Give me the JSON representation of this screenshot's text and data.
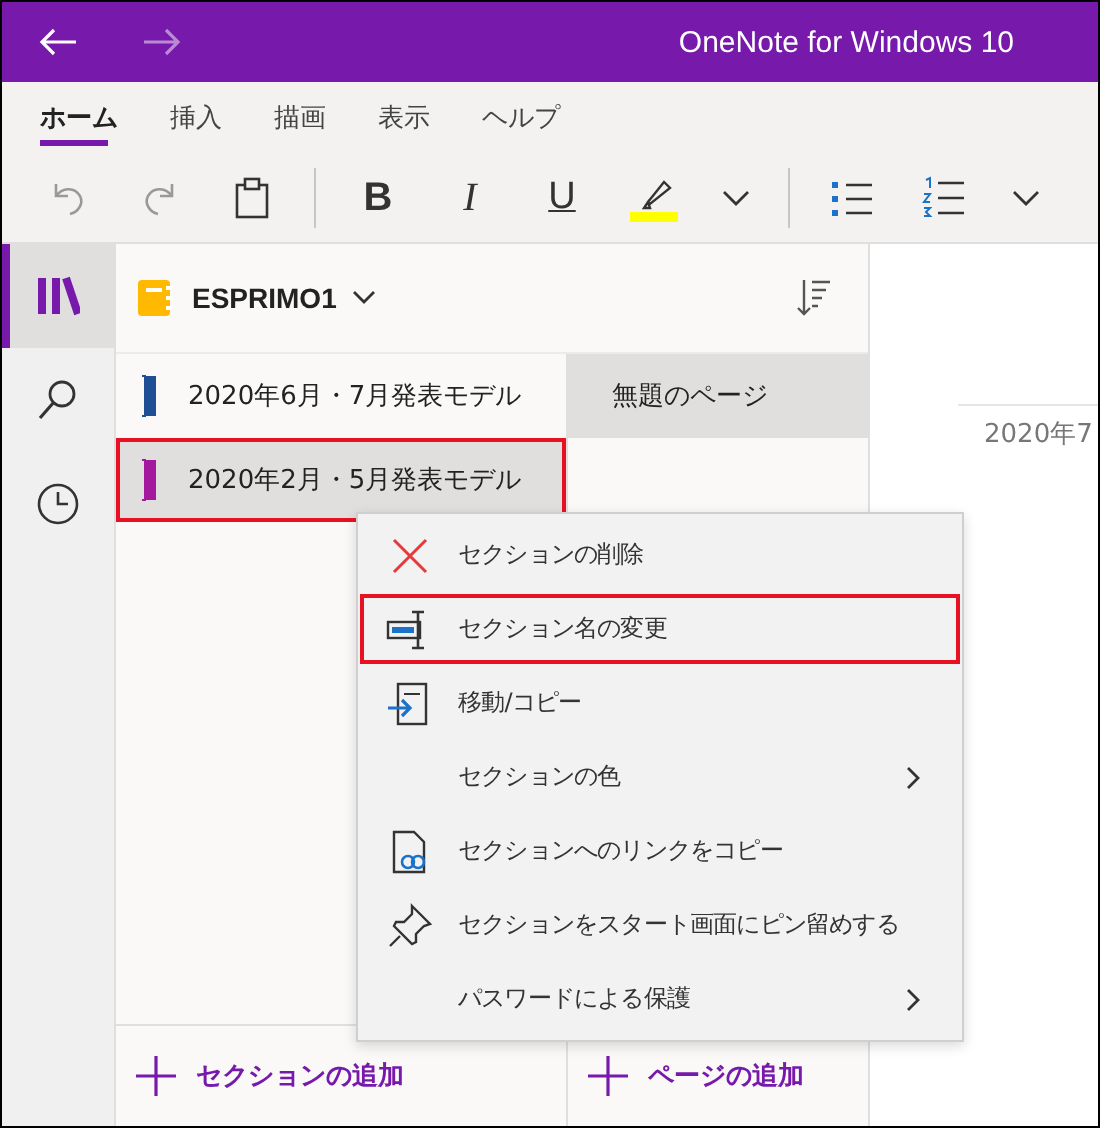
{
  "window": {
    "title": "OneNote for Windows 10",
    "back_enabled": true,
    "forward_enabled": false
  },
  "tabs": [
    {
      "label": "ホーム",
      "selected": true
    },
    {
      "label": "挿入",
      "selected": false
    },
    {
      "label": "描画",
      "selected": false
    },
    {
      "label": "表示",
      "selected": false
    },
    {
      "label": "ヘルプ",
      "selected": false
    }
  ],
  "toolbar": [
    {
      "kind": "undo",
      "disabled": true
    },
    {
      "kind": "redo",
      "disabled": true
    },
    {
      "kind": "paste",
      "disabled": false
    },
    {
      "kind": "divider"
    },
    {
      "kind": "bold",
      "label": "B"
    },
    {
      "kind": "italic",
      "label": "I"
    },
    {
      "kind": "underline",
      "label": "U"
    },
    {
      "kind": "highlight",
      "color": "#ffff00"
    },
    {
      "kind": "more"
    },
    {
      "kind": "divider"
    },
    {
      "kind": "bullets"
    },
    {
      "kind": "numbering"
    },
    {
      "kind": "more"
    }
  ],
  "rail": [
    {
      "kind": "notebooks",
      "selected": true
    },
    {
      "kind": "search",
      "selected": false
    },
    {
      "kind": "recent",
      "selected": false
    }
  ],
  "notebook": {
    "name": "ESPRIMO1"
  },
  "sections": [
    {
      "name": "2020年6月・7月発表モデル",
      "color": "#1e4e96",
      "selected": false,
      "highlighted": false
    },
    {
      "name": "2020年2月・5月発表モデル",
      "color": "#a4189f",
      "selected": true,
      "highlighted": true
    }
  ],
  "pages": [
    {
      "title": "無題のページ",
      "selected": true
    }
  ],
  "content": {
    "date": "2020年7"
  },
  "context_menu": [
    {
      "label": "セクションの削除",
      "kind": "delete",
      "submenu": false,
      "highlighted": false
    },
    {
      "label": "セクション名の変更",
      "kind": "rename",
      "submenu": false,
      "highlighted": true
    },
    {
      "label": "移動/コピー",
      "kind": "move",
      "submenu": false,
      "highlighted": false
    },
    {
      "label": "セクションの色",
      "kind": "plain",
      "submenu": true,
      "highlighted": false
    },
    {
      "label": "セクションへのリンクをコピー",
      "kind": "link",
      "submenu": false,
      "highlighted": false
    },
    {
      "label": "セクションをスタート画面にピン留めする",
      "kind": "pin",
      "submenu": false,
      "highlighted": false
    },
    {
      "label": "パスワードによる保護",
      "kind": "plain",
      "submenu": true,
      "highlighted": false
    }
  ],
  "footer": {
    "add_section": "セクションの追加",
    "add_page": "ページの追加"
  }
}
